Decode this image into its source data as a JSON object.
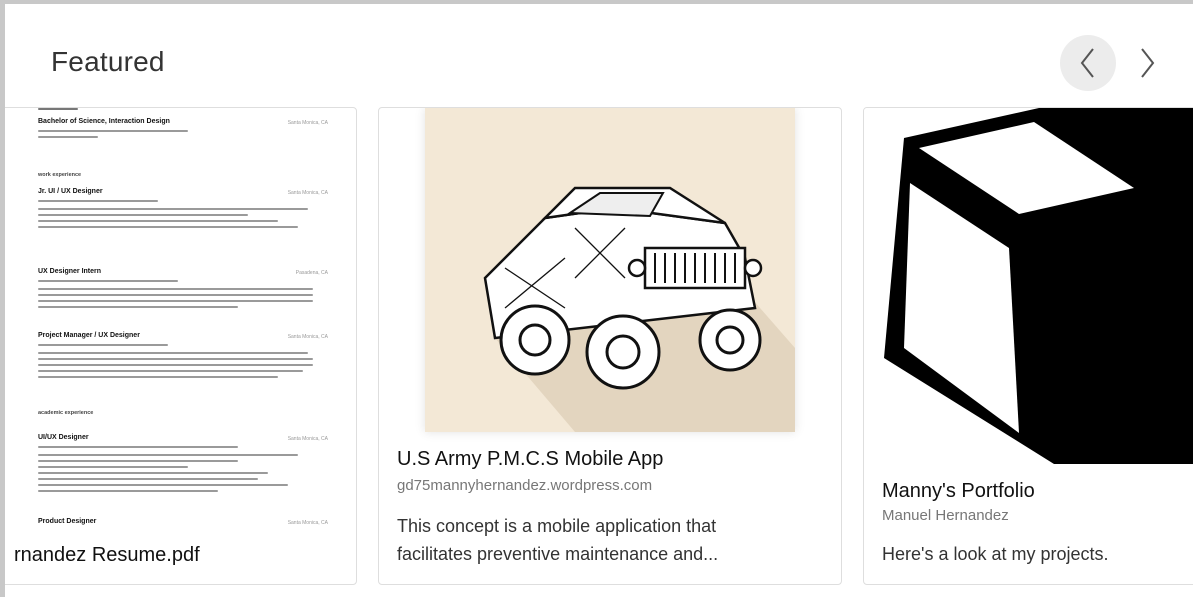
{
  "section": {
    "title": "Featured"
  },
  "nav": {
    "prev_icon": "chevron-left-icon",
    "next_icon": "chevron-right-icon"
  },
  "cards": [
    {
      "title": "rnandez Resume.pdf",
      "doc": {
        "entries": [
          {
            "heading": "Bachelor of Science, Interaction Design",
            "location": "Santa Monica, CA"
          },
          {
            "section": "work experience"
          },
          {
            "heading": "Jr. UI / UX Designer",
            "location": "Santa Monica, CA"
          },
          {
            "heading": "UX Designer Intern",
            "location": "Pasadena, CA"
          },
          {
            "heading": "Project Manager / UX Designer",
            "location": "Santa Monica, CA"
          },
          {
            "section": "academic experience"
          },
          {
            "heading": "UI/UX Designer",
            "location": "Santa Monica, CA"
          },
          {
            "heading": "Product Designer",
            "location": "Santa Monica, CA"
          }
        ]
      }
    },
    {
      "title": "U.S Army P.M.C.S Mobile App",
      "subtitle": "gd75mannyhernandez.wordpress.com",
      "description_line1": "This concept is a mobile application that",
      "description_line2": "facilitates preventive maintenance and...",
      "image_icon": "humvee-illustration"
    },
    {
      "title": "Manny's Portfolio",
      "subtitle": "Manuel Hernandez",
      "description": "Here's a look at my projects.",
      "image_icon": "cube-icon"
    }
  ]
}
